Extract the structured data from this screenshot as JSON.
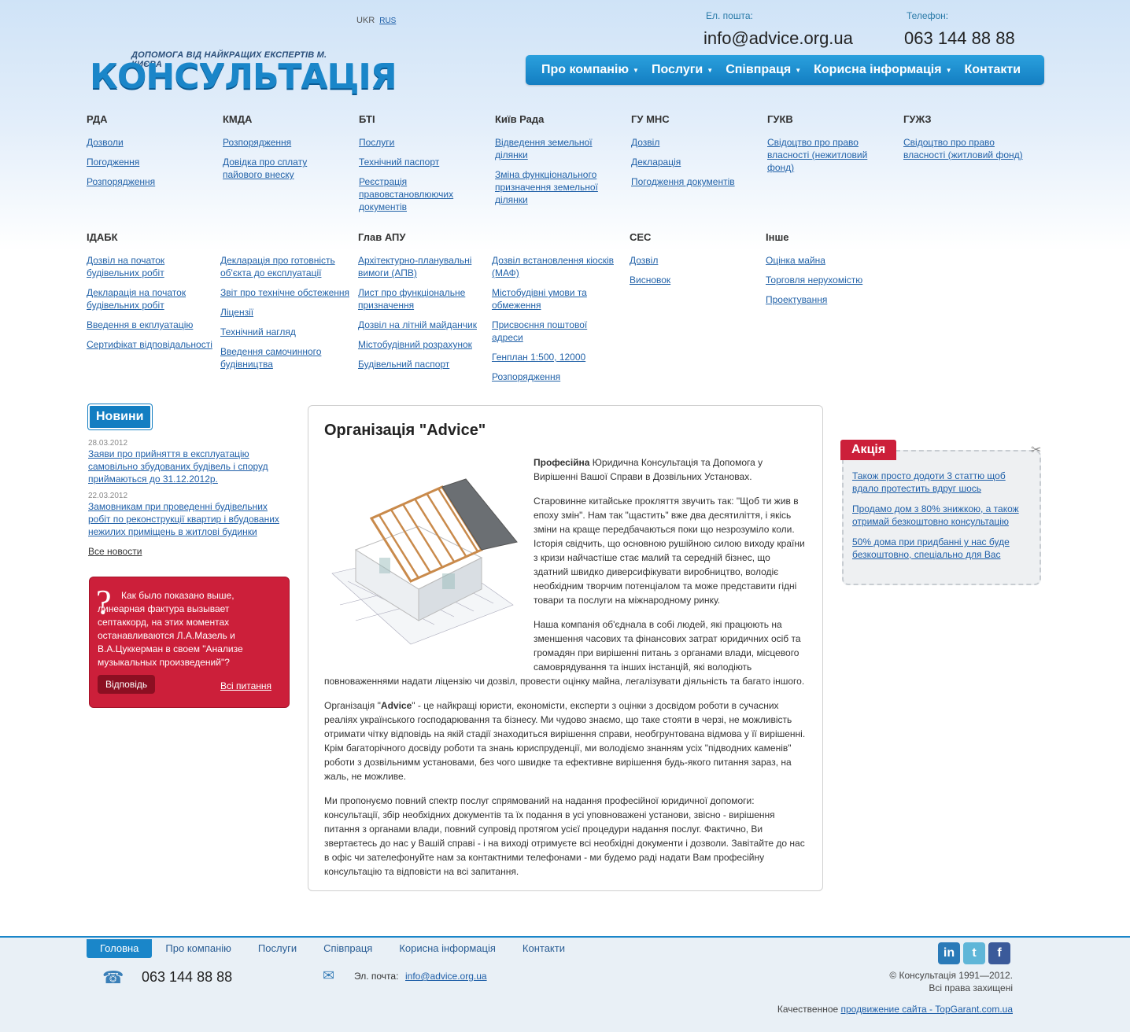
{
  "header": {
    "lang_current": "UKR",
    "lang_other": "RUS",
    "tagline": "ДОПОМОГА ВІД НАЙКРАЩИХ ЕКСПЕРТІВ М. КИЄВА",
    "logo": "КОНСУЛЬТАЦІЯ",
    "email_label": "Ел. пошта:",
    "email": "info@advice.org.ua",
    "phone_label": "Телефон:",
    "phone": "063 144 88 88"
  },
  "nav": [
    "Про компанію",
    "Послуги",
    "Співпраця",
    "Корисна інформація",
    "Контакти"
  ],
  "directory_row1": [
    {
      "title": "РДА",
      "links": [
        "Дозволи",
        "Погодження",
        "Розпорядження"
      ]
    },
    {
      "title": "КМДА",
      "links": [
        "Розпорядження",
        "Довідка про сплату пайового внеску"
      ]
    },
    {
      "title": "БТІ",
      "links": [
        "Послуги",
        "Технічний паспорт",
        "Реєстрація правовстановлюючих документів"
      ]
    },
    {
      "title": "Київ Рада",
      "links": [
        "Відведення земельної ділянки",
        "Зміна функціонального призначення земельної ділянки"
      ]
    },
    {
      "title": "ГУ МНС",
      "links": [
        "Дозвіл",
        "Декларація",
        "Погодження документів"
      ]
    },
    {
      "title": "ГУКВ",
      "links": [
        "Свідоцтво про право власності (нежитловий фонд)"
      ]
    },
    {
      "title": "ГУЖЗ",
      "links": [
        "Свідоцтво про право власності (житловий фонд)"
      ]
    }
  ],
  "directory_row2": [
    {
      "title": "ІДАБК",
      "links": [
        "Дозвіл на початок будівельних робіт",
        "Декларація на початок будівельних робіт",
        "Введення в екплуатацію",
        "Сертифікат відповідальності"
      ]
    },
    {
      "title": "",
      "links": [
        "Декларація про готовність об'єкта до експлуатації",
        "Звіт про технічне обстеження",
        "Ліцензії",
        "Технічний нагляд",
        "Введення самочинного будівництва"
      ]
    },
    {
      "title": "Глав АПУ",
      "links": [
        "Архітектурно-планувальні вимоги (АПВ)",
        "Лист про функціональне призначення",
        "Дозвіл на літній майданчик",
        "Містобудівний розрахунок",
        "Будівельний паспорт"
      ]
    },
    {
      "title": "",
      "links": [
        "Дозвіл встановлення кіосків (МАФ)",
        "Містобудівні умови та обмеження",
        "Присвоєння поштової адреси",
        "Генплан 1:500, 12000",
        "Розпорядження"
      ]
    },
    {
      "title": "СЕС",
      "links": [
        "Дозвіл",
        "Висновок"
      ]
    },
    {
      "title": "Інше",
      "links": [
        "Оцінка майна",
        "Торговля нерухомістю",
        "Проектування"
      ]
    }
  ],
  "news": {
    "heading": "Новини",
    "items": [
      {
        "date": "28.03.2012",
        "text": "Заяви про прийняття в експлуатацію самовільно збудованих будівель і споруд приймаються до 31.12.2012р."
      },
      {
        "date": "22.03.2012",
        "text": "Замовникам при проведенні будівельних робіт по реконструкції квартир і вбудованих нежилих приміщень в житлові будинки"
      }
    ],
    "all": "Все новости"
  },
  "faq": {
    "question": "Как было показано выше, линеарная фактура вызывает септаккорд, на этих моментах останавливаются Л.А.Мазель и В.А.Цуккерман в своем \"Анализе музыкальных произведений\"?",
    "answer_btn": "Відповідь",
    "all": "Всі питання"
  },
  "article": {
    "title": "Організація \"Advice\"",
    "p1_bold": "Професійна",
    "p1": " Юридична Консультація та Допомога у Вирішенні Вашої Справи в Дозвільних Установах.",
    "p2": "Старовинне китайське прокляття звучить так: \"Щоб ти жив в епоху змін\". Нам так \"щастить\" вже два десятиліття, і якісь зміни на краще передбачаються поки що незрозуміло коли. Історія свідчить, що основною рушійною силою виходу країни з кризи найчастіше стає малий та середній бізнес, що здатний швидко диверсифікувати виробництво, володіє необхідним творчим потенціалом та може представити гідні товари та послуги на міжнародному ринку.",
    "p3": "Наша компанія об'єднала в собі людей, які працюють на зменшення часових та фінансових затрат юридичних осіб та громадян при вирішенні питань з органами влади, місцевого самоврядування та інших інстанцій, які володіють повноваженнями надати ліцензію чи дозвіл, провести оцінку майна, легалізувати діяльність та багато іншого.",
    "p4_pre": "Організація \"",
    "p4_bold": "Advice",
    "p4": "\" - це найкращі юристи, економісти, експерти з оцінки з досвідом роботи в сучасних реаліях українського господарювання та бізнесу. Ми чудово знаємо, що таке стояти в черзі, не можливість отримати чітку відповідь на якій стадії знаходиться вирішення справи, необгрунтована відмова у її вирішенні. Крім багаторічного досвіду роботи та знань юриспруденції, ми володіємо знанням усіх \"підводних каменів\" роботи з дозвільнимм установами, без чого швидке та ефективне вирішення будь-якого питання зараз, на жаль, не можливе.",
    "p5": "Ми пропонуємо повний спектр послуг спрямований на надання професійної юридичної допомоги: консультації, збір необхідних документів та їх подання в усі уповноважені установи, звісно - вирішення питання з органами влади, повний супровід протягом усієї процедури надання послуг. Фактично, Ви звертаєтесь до нас у Вашій справі - і на виході отримуєте всі необхідні документи і дозволи. Завітайте до нас в офіс чи зателефонуйте нам за контактними телефонами - ми будемо раді надати Вам професійну консультацію та відповісти на всі запитання."
  },
  "promo": {
    "tag": "Акція",
    "links": [
      "Також просто додоти 3 статтю щоб вдало протестить вдруг шось",
      "Продамо дом з 80% знижкою, а також отримай безкоштовно консультацію",
      "50% дома при придбанні у нас буде безкоштовно, спеціально для Вас"
    ]
  },
  "footer": {
    "nav": [
      "Головна",
      "Про компанію",
      "Послуги",
      "Співпраця",
      "Корисна інформація",
      "Контакти"
    ],
    "phone": "063 144 88 88",
    "email_label": "Эл. почта:",
    "email": "info@advice.org.ua",
    "copyright": "© Консультація 1991—2012.",
    "rights": "Всі права захищені",
    "quality_prefix": "Качественное ",
    "quality_link": "продвижение сайта - TopGarant.com.ua",
    "social": [
      "in",
      "t",
      "f"
    ]
  }
}
